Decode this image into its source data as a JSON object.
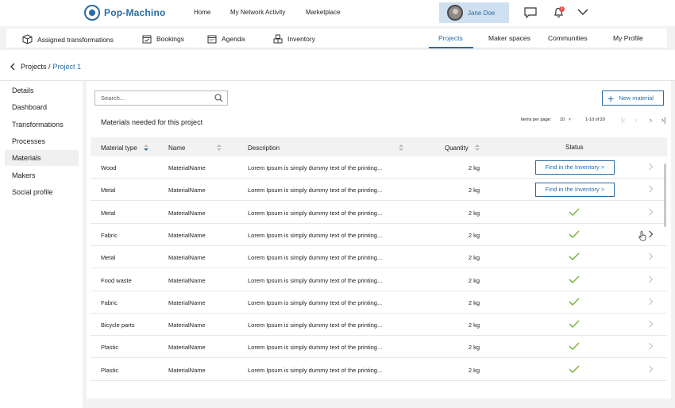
{
  "brand": {
    "name": "Pop-Machino"
  },
  "topnav": [
    {
      "label": "Home"
    },
    {
      "label": "My Network Activity"
    },
    {
      "label": "Marketplace"
    }
  ],
  "user": {
    "name": "Jane Doe"
  },
  "notifications": {
    "count": "1"
  },
  "subnav": {
    "left": [
      {
        "label": "Assigned transformations",
        "icon": "cube-icon"
      },
      {
        "label": "Bookings",
        "icon": "calendar-check-icon"
      },
      {
        "label": "Agenda",
        "icon": "calendar-icon"
      },
      {
        "label": "Inventory",
        "icon": "boxes-icon"
      }
    ],
    "right": [
      {
        "label": "Projects",
        "active": true
      },
      {
        "label": "Maker spaces"
      },
      {
        "label": "Communities"
      },
      {
        "label": "My Profile"
      }
    ]
  },
  "breadcrumb": {
    "parent": "Projects /",
    "current": "Project 1"
  },
  "sidebar": [
    {
      "label": "Details"
    },
    {
      "label": "Dashboard"
    },
    {
      "label": "Transformations"
    },
    {
      "label": "Processes"
    },
    {
      "label": "Materials",
      "active": true
    },
    {
      "label": "Makers"
    },
    {
      "label": "Social profile"
    }
  ],
  "search": {
    "placeholder": "Search..."
  },
  "new_material_label": "New material",
  "section_title": "Materials needed for this project",
  "pager": {
    "items_per_page_label": "Items per page:",
    "items_per_page_value": "10",
    "range": "1-10 of 20"
  },
  "table": {
    "headers": {
      "type": "Material type",
      "name": "Name",
      "description": "Description",
      "quantity": "Quantity",
      "status": "Status"
    },
    "find_label": "Find in the Inventory >",
    "rows": [
      {
        "type": "Wood",
        "name": "MaterialName",
        "description": "Lorem Ipsum is simply dummy text of the printing...",
        "quantity": "2 kg",
        "status": "find"
      },
      {
        "type": "Metal",
        "name": "MaterialName",
        "description": "Lorem Ipsum is simply dummy text of the printing...",
        "quantity": "2 kg",
        "status": "find"
      },
      {
        "type": "Metal",
        "name": "MaterialName",
        "description": "Lorem Ipsum is simply dummy text of the printing...",
        "quantity": "2 kg",
        "status": "ok"
      },
      {
        "type": "Fabric",
        "name": "MaterialName",
        "description": "Lorem Ipsum is simply dummy text of the printing...",
        "quantity": "2 kg",
        "status": "ok"
      },
      {
        "type": "Metal",
        "name": "MaterialName",
        "description": "Lorem Ipsum is simply dummy text of the printing...",
        "quantity": "2 kg",
        "status": "ok"
      },
      {
        "type": "Food waste",
        "name": "MaterialName",
        "description": "Lorem Ipsum is simply dummy text of the printing...",
        "quantity": "2 kg",
        "status": "ok"
      },
      {
        "type": "Fabric",
        "name": "MaterialName",
        "description": "Lorem Ipsum is simply dummy text of the printing...",
        "quantity": "2 kg",
        "status": "ok"
      },
      {
        "type": "Bicycle parts",
        "name": "MaterialName",
        "description": "Lorem Ipsum is simply dummy text of the printing...",
        "quantity": "2 kg",
        "status": "ok"
      },
      {
        "type": "Plastic",
        "name": "MaterialName",
        "description": "Lorem Ipsum is simply dummy text of the printing...",
        "quantity": "2 kg",
        "status": "ok"
      },
      {
        "type": "Plastic",
        "name": "MaterialName",
        "description": "Lorem Ipsum is simply dummy text of the printing...",
        "quantity": "2 kg",
        "status": "ok"
      }
    ]
  },
  "colors": {
    "accent": "#2b6ca3",
    "check": "#7cb342",
    "badge": "#e34b4b"
  }
}
